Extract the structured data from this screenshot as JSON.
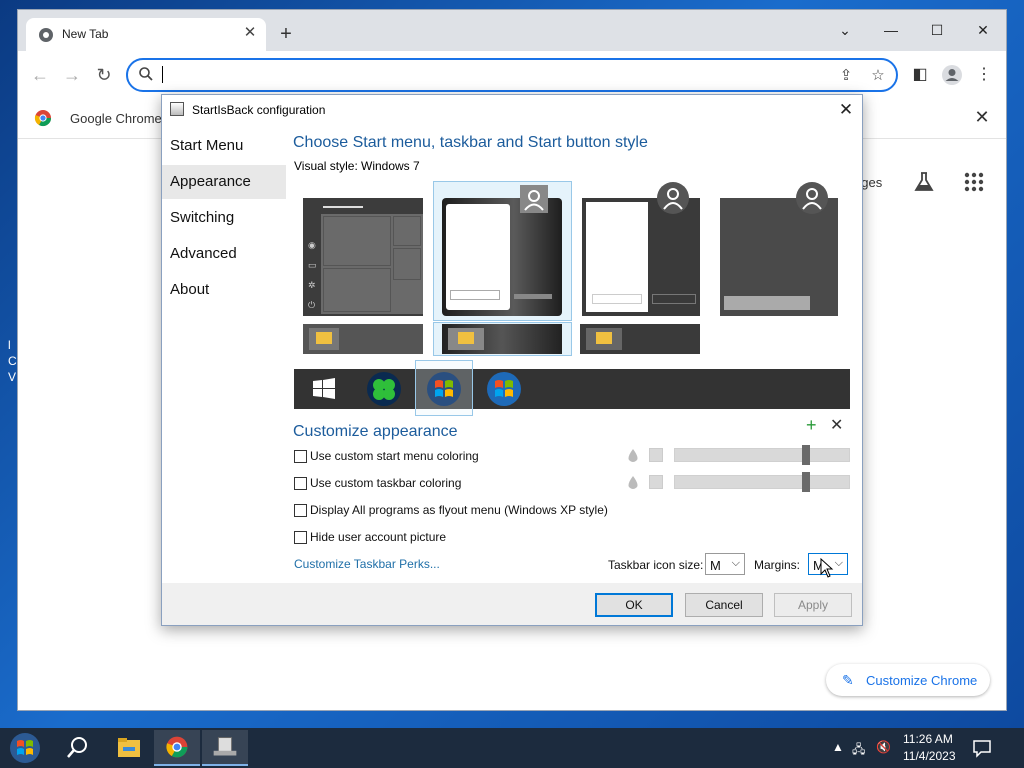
{
  "browser": {
    "tab_title": "New Tab",
    "omnibox_value": "",
    "infobar_text": "Google Chrome",
    "ntp_images_label": "ages",
    "customize_chrome_label": "Customize Chrome"
  },
  "dialog": {
    "title": "StartIsBack configuration",
    "sidebar": [
      {
        "label": "Start Menu",
        "selected": false
      },
      {
        "label": "Appearance",
        "selected": true
      },
      {
        "label": "Switching",
        "selected": false
      },
      {
        "label": "Advanced",
        "selected": false
      },
      {
        "label": "About",
        "selected": false
      }
    ],
    "style_heading": "Choose Start menu, taskbar and Start button style",
    "visual_style_label": "Visual style:",
    "visual_style_value": "Windows 7",
    "customize_heading": "Customize appearance",
    "checkboxes": [
      {
        "label": "Use custom start menu coloring",
        "checked": false
      },
      {
        "label": "Use custom taskbar coloring",
        "checked": false
      },
      {
        "label": "Display All programs as flyout menu (Windows XP style)",
        "checked": false
      },
      {
        "label": "Hide user account picture",
        "checked": false
      }
    ],
    "start_menu_slider_value": 0.75,
    "taskbar_slider_value": 0.75,
    "perks_link": "Customize Taskbar Perks...",
    "icon_size_label": "Taskbar icon size:",
    "icon_size_value": "M",
    "margins_label": "Margins:",
    "margins_value": "M",
    "ok_label": "OK",
    "cancel_label": "Cancel",
    "apply_label": "Apply",
    "colors": {
      "heading": "#1c5c9c",
      "link": "#1f6fa8",
      "selection": "#e5f3fb",
      "accent": "#0078d7"
    }
  },
  "taskbar": {
    "time": "11:26 AM",
    "date": "11/4/2023"
  }
}
